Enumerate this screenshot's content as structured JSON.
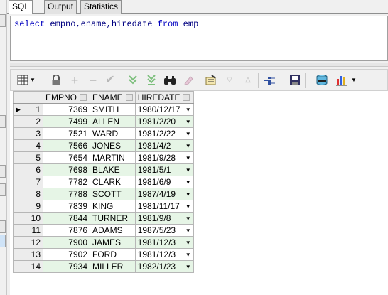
{
  "tabs": [
    {
      "label": "SQL",
      "active": true
    },
    {
      "label": "Output",
      "active": false
    },
    {
      "label": "Statistics",
      "active": false
    }
  ],
  "editor": {
    "tokens": [
      {
        "text": "select",
        "kind": "kw"
      },
      {
        "text": " ",
        "kind": "plain"
      },
      {
        "text": "empno,ename,hiredate",
        "kind": "id"
      },
      {
        "text": " ",
        "kind": "plain"
      },
      {
        "text": "from",
        "kind": "kw"
      },
      {
        "text": " ",
        "kind": "plain"
      },
      {
        "text": "emp",
        "kind": "id"
      }
    ]
  },
  "toolbar": {
    "icons": [
      "grid-select-icon",
      "lock-icon",
      "add-row-icon",
      "delete-row-icon",
      "post-changes-icon",
      "fetch-next-icon",
      "fetch-last-icon",
      "find-icon",
      "clear-icon",
      "query-by-example-icon",
      "filter-down-icon",
      "filter-up-icon",
      "link-icon",
      "save-icon",
      "export-icon",
      "chart-icon"
    ]
  },
  "grid": {
    "columns": [
      "EMPNO",
      "ENAME",
      "HIREDATE"
    ],
    "rows": [
      {
        "n": "1",
        "empno": "7369",
        "ename": "SMITH",
        "hiredate": "1980/12/17"
      },
      {
        "n": "2",
        "empno": "7499",
        "ename": "ALLEN",
        "hiredate": "1981/2/20"
      },
      {
        "n": "3",
        "empno": "7521",
        "ename": "WARD",
        "hiredate": "1981/2/22"
      },
      {
        "n": "4",
        "empno": "7566",
        "ename": "JONES",
        "hiredate": "1981/4/2"
      },
      {
        "n": "5",
        "empno": "7654",
        "ename": "MARTIN",
        "hiredate": "1981/9/28"
      },
      {
        "n": "6",
        "empno": "7698",
        "ename": "BLAKE",
        "hiredate": "1981/5/1"
      },
      {
        "n": "7",
        "empno": "7782",
        "ename": "CLARK",
        "hiredate": "1981/6/9"
      },
      {
        "n": "8",
        "empno": "7788",
        "ename": "SCOTT",
        "hiredate": "1987/4/19"
      },
      {
        "n": "9",
        "empno": "7839",
        "ename": "KING",
        "hiredate": "1981/11/17"
      },
      {
        "n": "10",
        "empno": "7844",
        "ename": "TURNER",
        "hiredate": "1981/9/8"
      },
      {
        "n": "11",
        "empno": "7876",
        "ename": "ADAMS",
        "hiredate": "1987/5/23"
      },
      {
        "n": "12",
        "empno": "7900",
        "ename": "JAMES",
        "hiredate": "1981/12/3"
      },
      {
        "n": "13",
        "empno": "7902",
        "ename": "FORD",
        "hiredate": "1981/12/3"
      },
      {
        "n": "14",
        "empno": "7934",
        "ename": "MILLER",
        "hiredate": "1982/1/23"
      }
    ],
    "current_row": 1
  },
  "colors": {
    "keyword": "#0000c0",
    "identifier": "#000080",
    "alt_row": "#e6f5e6"
  }
}
